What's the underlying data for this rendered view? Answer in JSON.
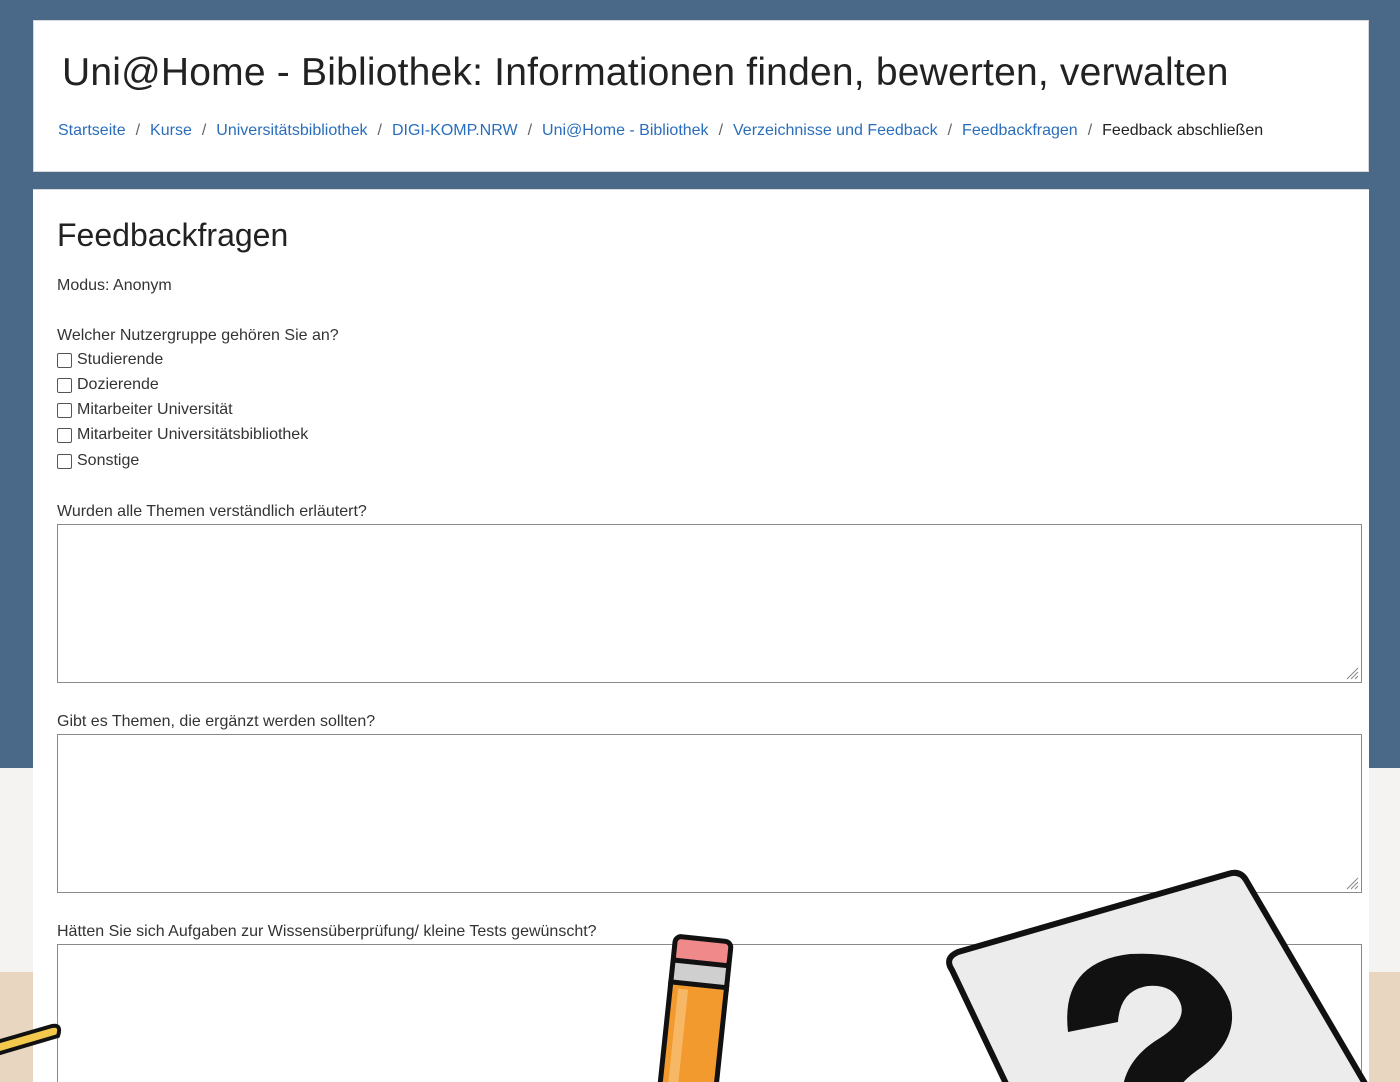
{
  "header": {
    "title": "Uni@Home - Bibliothek: Informationen finden, bewerten, verwalten",
    "breadcrumb": [
      {
        "label": "Startseite"
      },
      {
        "label": "Kurse"
      },
      {
        "label": "Universitätsbibliothek"
      },
      {
        "label": "DIGI-KOMP.NRW"
      },
      {
        "label": "Uni@Home - Bibliothek"
      },
      {
        "label": "Verzeichnisse und Feedback"
      },
      {
        "label": "Feedbackfragen"
      }
    ],
    "breadcrumb_current": "Feedback abschließen",
    "separator": "/"
  },
  "main": {
    "heading": "Feedbackfragen",
    "mode": "Modus: Anonym",
    "q1": {
      "label": "Welcher Nutzergruppe gehören Sie an?",
      "options": [
        "Studierende",
        "Dozierende",
        "Mitarbeiter Universität",
        "Mitarbeiter Universitätsbibliothek",
        "Sonstige"
      ]
    },
    "q2": {
      "label": "Wurden alle Themen verständlich erläutert?",
      "value": ""
    },
    "q3": {
      "label": "Gibt es Themen, die ergänzt werden sollten?",
      "value": ""
    },
    "q4": {
      "label": "Hätten Sie sich Aufgaben zur Wissensüberprüfung/ kleine Tests gewünscht?",
      "value": ""
    }
  },
  "colors": {
    "background": "#4a6888",
    "link": "#2a6ebb",
    "pencil": "#f39a2e",
    "eraser": "#f08a8a"
  },
  "decorations": {
    "pencil": "pencil-icon",
    "question_card": "question-mark-icon",
    "yellow_stick": "stick-icon"
  }
}
